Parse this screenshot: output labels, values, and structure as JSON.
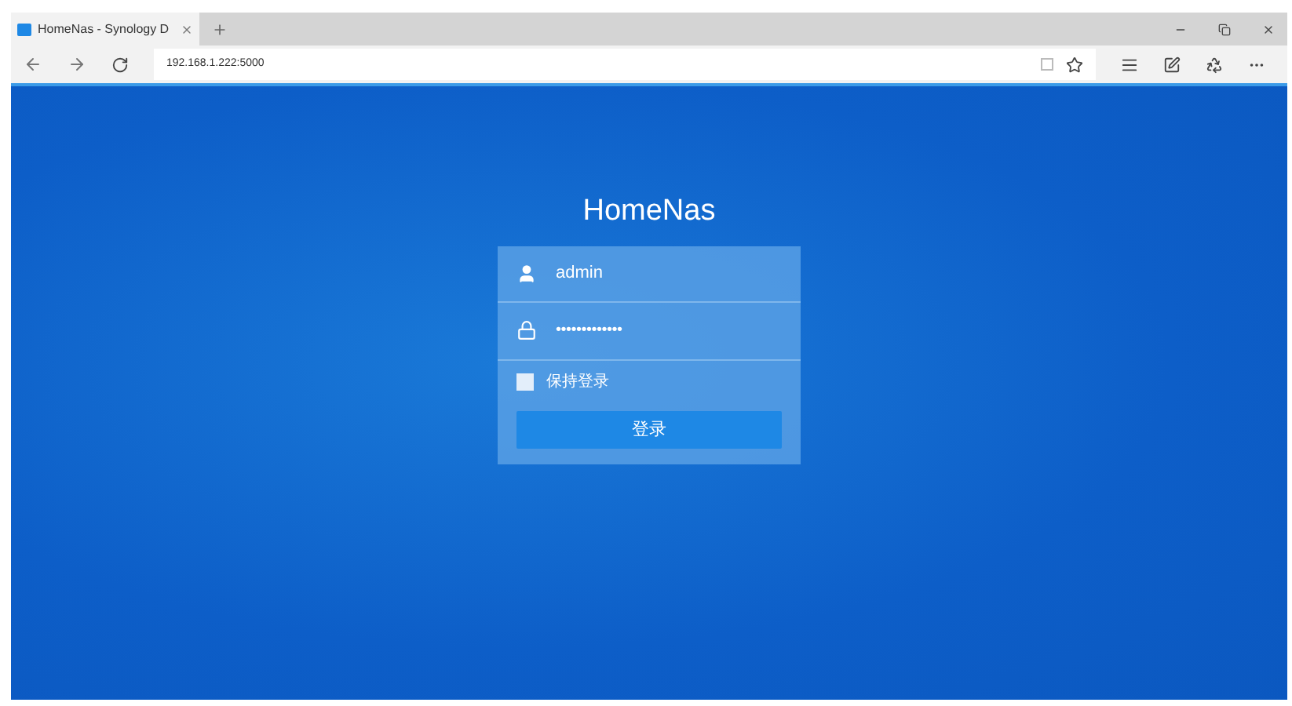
{
  "browser": {
    "tab": {
      "title": "HomeNas - Synology D",
      "selected": true
    },
    "address": "192.168.1.222:5000"
  },
  "login": {
    "title": "HomeNas",
    "username": "admin",
    "password": "•••••••••••••",
    "remember": {
      "label": "保持登录",
      "checked": false
    },
    "submit": "登录"
  }
}
